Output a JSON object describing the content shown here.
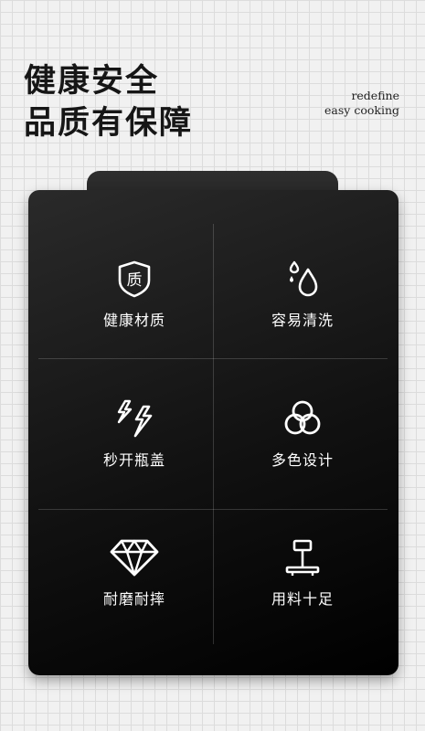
{
  "headline": {
    "line1": "健康安全",
    "line2": "品质有保障"
  },
  "tagline": {
    "line1": "redefine",
    "line2": "easy cooking"
  },
  "features": [
    {
      "label": "健康材质",
      "icon": "shield-quality-icon",
      "glyph": "质"
    },
    {
      "label": "容易清洗",
      "icon": "water-drops-icon"
    },
    {
      "label": "秒开瓶盖",
      "icon": "lightning-icon"
    },
    {
      "label": "多色设计",
      "icon": "color-circles-icon"
    },
    {
      "label": "耐磨耐摔",
      "icon": "diamond-icon"
    },
    {
      "label": "用料十足",
      "icon": "scale-icon"
    }
  ]
}
